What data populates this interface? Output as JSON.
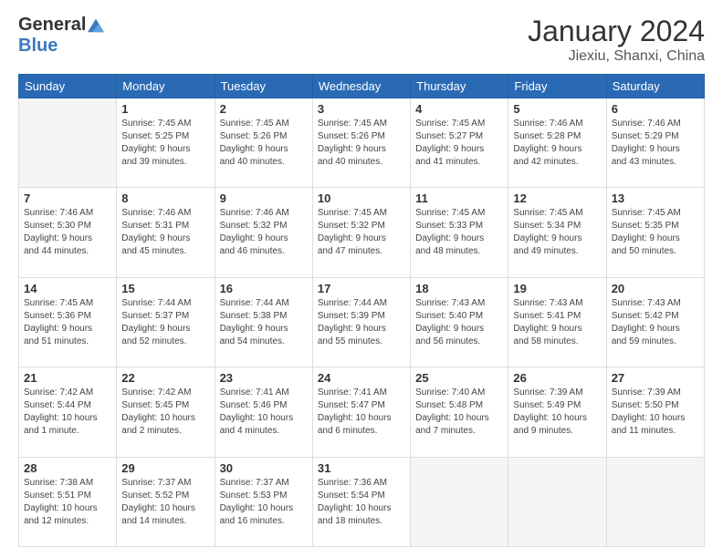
{
  "logo": {
    "general": "General",
    "blue": "Blue"
  },
  "title": "January 2024",
  "location": "Jiexiu, Shanxi, China",
  "days_of_week": [
    "Sunday",
    "Monday",
    "Tuesday",
    "Wednesday",
    "Thursday",
    "Friday",
    "Saturday"
  ],
  "weeks": [
    [
      {
        "day": "",
        "info": ""
      },
      {
        "day": "1",
        "info": "Sunrise: 7:45 AM\nSunset: 5:25 PM\nDaylight: 9 hours\nand 39 minutes."
      },
      {
        "day": "2",
        "info": "Sunrise: 7:45 AM\nSunset: 5:26 PM\nDaylight: 9 hours\nand 40 minutes."
      },
      {
        "day": "3",
        "info": "Sunrise: 7:45 AM\nSunset: 5:26 PM\nDaylight: 9 hours\nand 40 minutes."
      },
      {
        "day": "4",
        "info": "Sunrise: 7:45 AM\nSunset: 5:27 PM\nDaylight: 9 hours\nand 41 minutes."
      },
      {
        "day": "5",
        "info": "Sunrise: 7:46 AM\nSunset: 5:28 PM\nDaylight: 9 hours\nand 42 minutes."
      },
      {
        "day": "6",
        "info": "Sunrise: 7:46 AM\nSunset: 5:29 PM\nDaylight: 9 hours\nand 43 minutes."
      }
    ],
    [
      {
        "day": "7",
        "info": "Sunrise: 7:46 AM\nSunset: 5:30 PM\nDaylight: 9 hours\nand 44 minutes."
      },
      {
        "day": "8",
        "info": "Sunrise: 7:46 AM\nSunset: 5:31 PM\nDaylight: 9 hours\nand 45 minutes."
      },
      {
        "day": "9",
        "info": "Sunrise: 7:46 AM\nSunset: 5:32 PM\nDaylight: 9 hours\nand 46 minutes."
      },
      {
        "day": "10",
        "info": "Sunrise: 7:45 AM\nSunset: 5:32 PM\nDaylight: 9 hours\nand 47 minutes."
      },
      {
        "day": "11",
        "info": "Sunrise: 7:45 AM\nSunset: 5:33 PM\nDaylight: 9 hours\nand 48 minutes."
      },
      {
        "day": "12",
        "info": "Sunrise: 7:45 AM\nSunset: 5:34 PM\nDaylight: 9 hours\nand 49 minutes."
      },
      {
        "day": "13",
        "info": "Sunrise: 7:45 AM\nSunset: 5:35 PM\nDaylight: 9 hours\nand 50 minutes."
      }
    ],
    [
      {
        "day": "14",
        "info": "Sunrise: 7:45 AM\nSunset: 5:36 PM\nDaylight: 9 hours\nand 51 minutes."
      },
      {
        "day": "15",
        "info": "Sunrise: 7:44 AM\nSunset: 5:37 PM\nDaylight: 9 hours\nand 52 minutes."
      },
      {
        "day": "16",
        "info": "Sunrise: 7:44 AM\nSunset: 5:38 PM\nDaylight: 9 hours\nand 54 minutes."
      },
      {
        "day": "17",
        "info": "Sunrise: 7:44 AM\nSunset: 5:39 PM\nDaylight: 9 hours\nand 55 minutes."
      },
      {
        "day": "18",
        "info": "Sunrise: 7:43 AM\nSunset: 5:40 PM\nDaylight: 9 hours\nand 56 minutes."
      },
      {
        "day": "19",
        "info": "Sunrise: 7:43 AM\nSunset: 5:41 PM\nDaylight: 9 hours\nand 58 minutes."
      },
      {
        "day": "20",
        "info": "Sunrise: 7:43 AM\nSunset: 5:42 PM\nDaylight: 9 hours\nand 59 minutes."
      }
    ],
    [
      {
        "day": "21",
        "info": "Sunrise: 7:42 AM\nSunset: 5:44 PM\nDaylight: 10 hours\nand 1 minute."
      },
      {
        "day": "22",
        "info": "Sunrise: 7:42 AM\nSunset: 5:45 PM\nDaylight: 10 hours\nand 2 minutes."
      },
      {
        "day": "23",
        "info": "Sunrise: 7:41 AM\nSunset: 5:46 PM\nDaylight: 10 hours\nand 4 minutes."
      },
      {
        "day": "24",
        "info": "Sunrise: 7:41 AM\nSunset: 5:47 PM\nDaylight: 10 hours\nand 6 minutes."
      },
      {
        "day": "25",
        "info": "Sunrise: 7:40 AM\nSunset: 5:48 PM\nDaylight: 10 hours\nand 7 minutes."
      },
      {
        "day": "26",
        "info": "Sunrise: 7:39 AM\nSunset: 5:49 PM\nDaylight: 10 hours\nand 9 minutes."
      },
      {
        "day": "27",
        "info": "Sunrise: 7:39 AM\nSunset: 5:50 PM\nDaylight: 10 hours\nand 11 minutes."
      }
    ],
    [
      {
        "day": "28",
        "info": "Sunrise: 7:38 AM\nSunset: 5:51 PM\nDaylight: 10 hours\nand 12 minutes."
      },
      {
        "day": "29",
        "info": "Sunrise: 7:37 AM\nSunset: 5:52 PM\nDaylight: 10 hours\nand 14 minutes."
      },
      {
        "day": "30",
        "info": "Sunrise: 7:37 AM\nSunset: 5:53 PM\nDaylight: 10 hours\nand 16 minutes."
      },
      {
        "day": "31",
        "info": "Sunrise: 7:36 AM\nSunset: 5:54 PM\nDaylight: 10 hours\nand 18 minutes."
      },
      {
        "day": "",
        "info": ""
      },
      {
        "day": "",
        "info": ""
      },
      {
        "day": "",
        "info": ""
      }
    ]
  ]
}
